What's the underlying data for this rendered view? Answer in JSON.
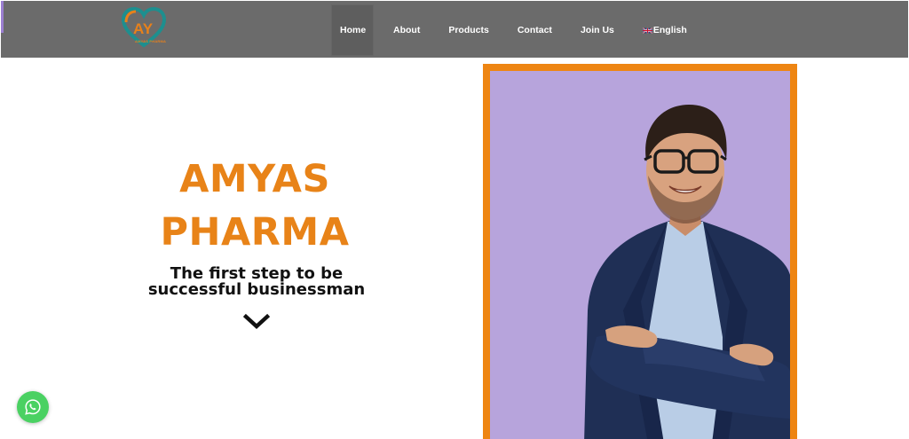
{
  "colors": {
    "nav_bg": "#6b6b6b",
    "brand_orange": "#e88318",
    "photo_bg": "#b7a4dc",
    "whatsapp_green": "#4ad162"
  },
  "header": {
    "logo_icon": "amyas-heart-logo-icon",
    "logo_letters": "AY",
    "logo_caption": "AMYAS PHARMA",
    "nav": [
      {
        "label": "Home",
        "active": true
      },
      {
        "label": "About"
      },
      {
        "label": "Products"
      },
      {
        "label": "Contact"
      },
      {
        "label": "Join Us"
      },
      {
        "label": "English",
        "icon": "uk-flag-icon"
      }
    ]
  },
  "hero": {
    "title_line1": "AMYAS",
    "title_line2": "PHARMA",
    "subtitle_line1": "The first step to be",
    "subtitle_line2": "successful businessman",
    "scroll_icon": "chevron-down-icon"
  },
  "photo": {
    "subject": "smiling-businessman-photo"
  },
  "floating": {
    "whatsapp_icon": "whatsapp-icon"
  }
}
